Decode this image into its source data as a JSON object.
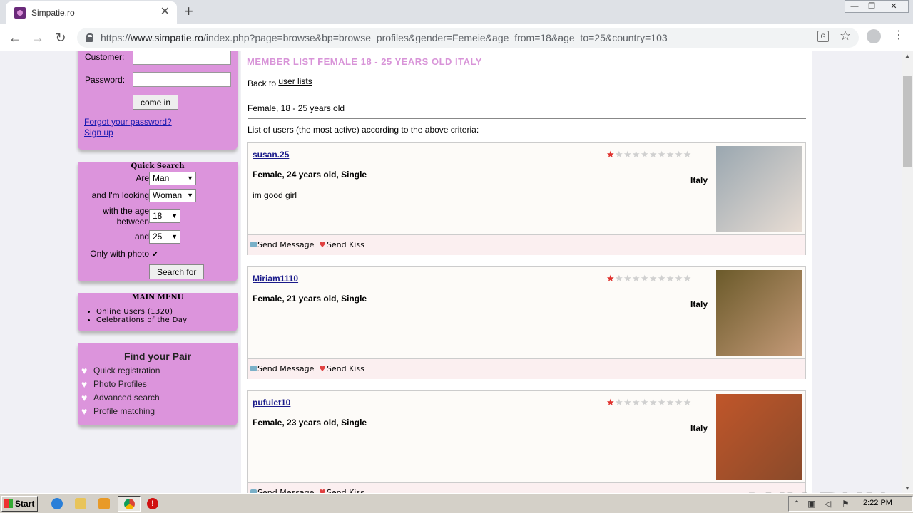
{
  "browser": {
    "tab_title": "Simpatie.ro",
    "new_tab_symbol": "+",
    "tab_close_symbol": "✕",
    "url_prefix": "https://",
    "url_host": "www.simpatie.ro",
    "url_path": "/index.php?page=browse&bp=browse_profiles&gender=Femeie&age_from=18&age_to=25&country=103",
    "window_controls": [
      "—",
      "❐",
      "✕"
    ]
  },
  "login": {
    "customer_label": "Customer:",
    "password_label": "Password:",
    "submit_label": "come in",
    "forgot_link": "Forgot your password?",
    "signup_link": "Sign up"
  },
  "quick_search": {
    "title": "Quick Search",
    "are_label": "Are",
    "are_value": "Man",
    "looking_label": "and I'm looking",
    "looking_value": "Woman",
    "age_label": "with the age between",
    "age_from": "18",
    "and_label": "and",
    "age_to": "25",
    "photo_label": "Only with photo",
    "photo_checked": true,
    "search_button": "Search for"
  },
  "main_menu": {
    "title": "MAIN MENU",
    "items": [
      "Online Users (1320)",
      "Celebrations of the Day"
    ]
  },
  "find_pair": {
    "title": "Find your Pair",
    "items": [
      "Quick registration",
      "Photo Profiles",
      "Advanced search",
      "Profile matching"
    ]
  },
  "content": {
    "page_title": "MEMBER LIST FEMALE 18 - 25 YEARS OLD ITALY",
    "back_prefix": "Back to",
    "back_link": "user lists",
    "criteria": "Female, 18 - 25 years old",
    "list_intro": "List of users (the most active) according to the above criteria:",
    "send_message": "Send Message",
    "send_kiss": "Send Kiss",
    "members": [
      {
        "username": "susan.25",
        "info": "Female, 24 years old, Single",
        "description": "im good girl",
        "country": "Italy",
        "rating": 1,
        "rating_max": 10,
        "photo_colors": [
          "#9aa7b0",
          "#e8ddd4"
        ]
      },
      {
        "username": "Miriam1110",
        "info": "Female, 21 years old, Single",
        "description": "",
        "country": "Italy",
        "rating": 1,
        "rating_max": 10,
        "photo_colors": [
          "#6b5a2a",
          "#c49a78"
        ]
      },
      {
        "username": "pufulet10",
        "info": "Female, 23 years old, Single",
        "description": "",
        "country": "Italy",
        "rating": 1,
        "rating_max": 10,
        "photo_colors": [
          "#c0562a",
          "#8a4a2a"
        ]
      }
    ]
  },
  "watermark": "ANY RUN",
  "taskbar": {
    "start_label": "Start",
    "clock": "2:22 PM"
  }
}
